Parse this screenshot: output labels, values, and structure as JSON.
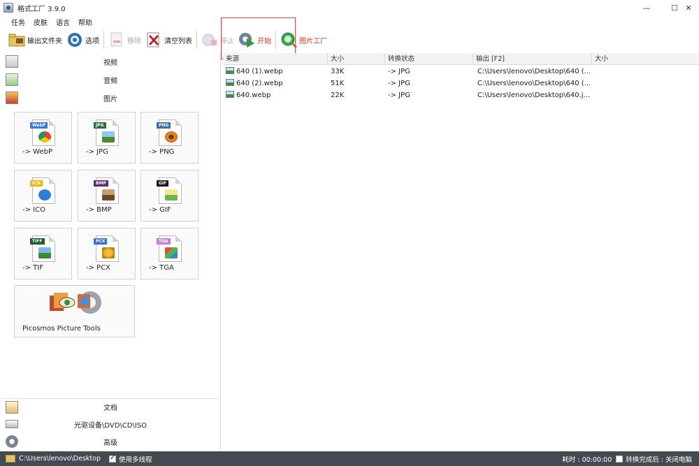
{
  "window": {
    "title": "格式工厂 3.9.0",
    "minimize": "—",
    "maximize": "☐",
    "close": "✕"
  },
  "menu": [
    "任务",
    "皮肤",
    "语言",
    "帮助"
  ],
  "toolbar": {
    "output_folder": "输出文件夹",
    "options": "选项",
    "remove": "移除",
    "clear_list": "清空列表",
    "stop": "停止",
    "start": "开始",
    "picture_factory": "图片工厂"
  },
  "categories": {
    "video": "视频",
    "audio": "音频",
    "picture": "图片",
    "document": "文档",
    "rom": "光驱设备\\DVD\\CD\\ISO",
    "advanced": "高级"
  },
  "tiles": [
    {
      "label": "-> WebP",
      "tag": "WebP",
      "tag_color": "#3a7bd5"
    },
    {
      "label": "-> JPG",
      "tag": "JPG",
      "tag_color": "#2b6e3a"
    },
    {
      "label": "-> PNG",
      "tag": "PNG",
      "tag_color": "#3a6fa8"
    },
    {
      "label": "-> ICO",
      "tag": "ICO",
      "tag_color": "#e8b820"
    },
    {
      "label": "-> BMP",
      "tag": "BMP",
      "tag_color": "#5b2a7a"
    },
    {
      "label": "-> GIF",
      "tag": "GIF",
      "tag_color": "#1a1a1a"
    },
    {
      "label": "-> TIF",
      "tag": "TIFF",
      "tag_color": "#1f5a2a"
    },
    {
      "label": "-> PCX",
      "tag": "PCX",
      "tag_color": "#3a6fcf"
    },
    {
      "label": "-> TGA",
      "tag": "TGA",
      "tag_color": "#c080d8"
    }
  ],
  "picosmos": {
    "label": "Picosmos Picture Tools"
  },
  "file_list": {
    "headers": [
      "来源",
      "大小",
      "转换状态",
      "输出 [F2]",
      "大小"
    ],
    "rows": [
      {
        "source": "640 (1).webp",
        "size": "33K",
        "status": "-> JPG",
        "output": "C:\\Users\\lenovo\\Desktop\\640 (...",
        "out_size": ""
      },
      {
        "source": "640 (2).webp",
        "size": "51K",
        "status": "-> JPG",
        "output": "C:\\Users\\lenovo\\Desktop\\640 (...",
        "out_size": ""
      },
      {
        "source": "640.webp",
        "size": "22K",
        "status": "-> JPG",
        "output": "C:\\Users\\lenovo\\Desktop\\640.j...",
        "out_size": ""
      }
    ]
  },
  "status_bar": {
    "path": "C:\\Users\\lenovo\\Desktop",
    "multithread": "使用多线程",
    "elapsed": "耗时 : 00:00:00",
    "after_convert": "转换完成后 : 关闭电脑"
  },
  "colors": {
    "status_bar_bg": "#444a52",
    "highlight_border": "#e0484a",
    "start_text": "#d83a1a"
  }
}
